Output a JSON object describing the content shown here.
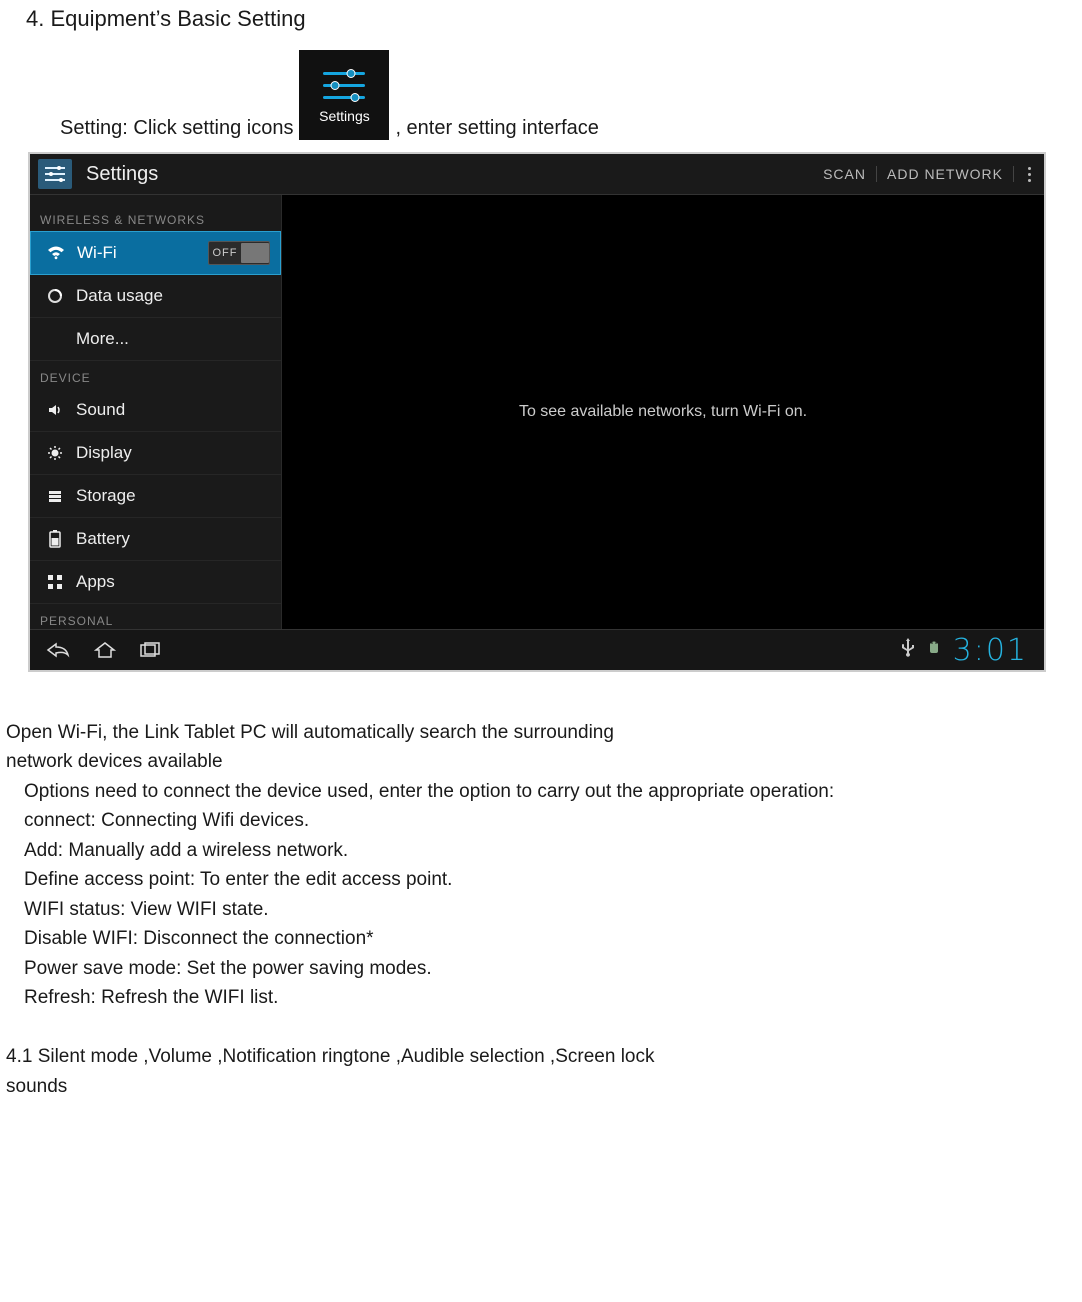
{
  "doc": {
    "heading": "4. Equipment’s Basic Setting",
    "setting_pre": "Setting: Click setting icons ",
    "setting_post": ", enter setting interface",
    "settings_badge_label": "Settings",
    "body_lines": [
      "Open Wi-Fi, the Link Tablet PC will automatically search the surrounding",
      " network devices available",
      "Options need to connect the device used, enter the option to carry out the appropriate operation:",
      " connect: Connecting Wifi devices.",
      "Add: Manually add a wireless network.",
      "Define access point: To enter the edit access point.",
      "WIFI status: View WIFI state.",
      "Disable WIFI: Disconnect the connection*",
      "Power save mode: Set the power saving modes.",
      "Refresh: Refresh the WIFI list."
    ],
    "section_41": "4.1 Silent mode ,Volume ,Notification ringtone ,Audible selection ,Screen lock",
    "section_41b": "sounds"
  },
  "ui": {
    "title": "Settings",
    "header_buttons": {
      "scan": "SCAN",
      "add": "ADD NETWORK"
    },
    "sections": {
      "wireless": "WIRELESS & NETWORKS",
      "device": "DEVICE",
      "personal": "PERSONAL"
    },
    "wifi": {
      "label": "Wi-Fi",
      "toggle": "OFF"
    },
    "items": {
      "data_usage": "Data usage",
      "more": "More...",
      "sound": "Sound",
      "display": "Display",
      "storage": "Storage",
      "battery": "Battery",
      "apps": "Apps"
    },
    "main_message": "To see available networks, turn Wi-Fi on.",
    "clock": "3:01"
  }
}
